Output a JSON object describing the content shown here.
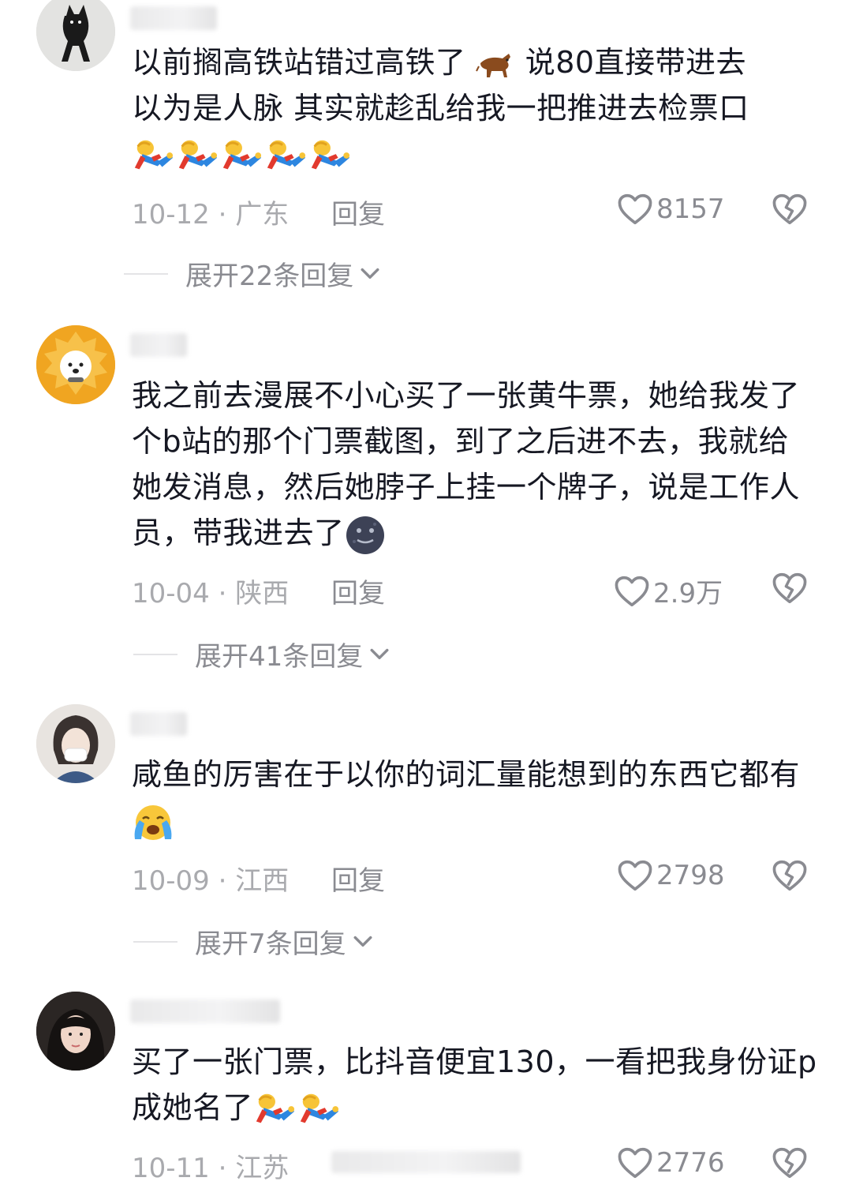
{
  "comments": [
    {
      "text_line1": "以前搁高铁站错过高铁了",
      "text_line1b": "说80直接带进去",
      "text_line2": "以为是人脉 其实就趁乱给我一把推进去检票口",
      "date_loc": "10-12 · 广东",
      "reply_label": "回复",
      "likes": "8157",
      "expand_label": "展开22条回复",
      "emojis": [
        "bull-emoji",
        "running-person-emoji"
      ]
    },
    {
      "text": "我之前去漫展不小心买了一张黄牛票，她给我发了个b站的那个门票截图，到了之后进不去，我就给她发消息，然后她脖子上挂一个牌子，说是工作人员，带我进去了",
      "date_loc": "10-04 · 陕西",
      "reply_label": "回复",
      "likes": "2.9万",
      "expand_label": "展开41条回复",
      "emojis": [
        "moon-face-emoji"
      ]
    },
    {
      "text": "咸鱼的厉害在于以你的词汇量能想到的东西它都有",
      "date_loc": "10-09 · 江西",
      "reply_label": "回复",
      "likes": "2798",
      "expand_label": "展开7条回复",
      "emojis": [
        "crying-face-emoji"
      ]
    },
    {
      "text": "买了一张门票，比抖音便宜130，一看把我身份证p成她名了",
      "date_loc": "10-11 · 江苏",
      "likes": "2776",
      "emojis": [
        "running-person-emoji"
      ]
    }
  ],
  "colors": {
    "text": "#161823",
    "meta": "#a9aaae",
    "muted": "#8a8b91"
  }
}
